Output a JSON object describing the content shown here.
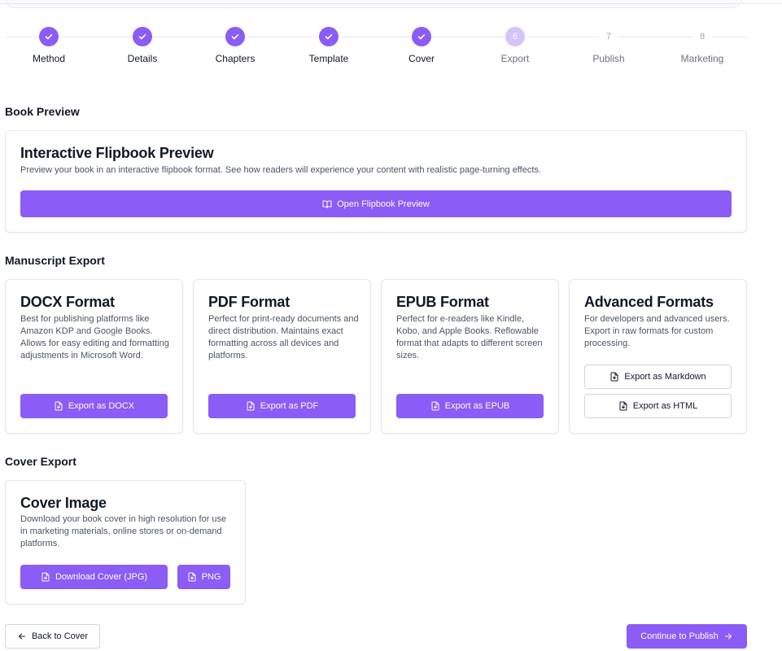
{
  "stepper": {
    "steps": [
      {
        "label": "Method",
        "number": "1",
        "state": "done"
      },
      {
        "label": "Details",
        "number": "2",
        "state": "done"
      },
      {
        "label": "Chapters",
        "number": "3",
        "state": "done"
      },
      {
        "label": "Template",
        "number": "4",
        "state": "done"
      },
      {
        "label": "Cover",
        "number": "5",
        "state": "done"
      },
      {
        "label": "Export",
        "number": "6",
        "state": "current"
      },
      {
        "label": "Publish",
        "number": "7",
        "state": "upcoming"
      },
      {
        "label": "Marketing",
        "number": "8",
        "state": "upcoming"
      }
    ]
  },
  "book_preview": {
    "section_title": "Book Preview",
    "card_title": "Interactive Flipbook Preview",
    "description": "Preview your book in an interactive flipbook format. See how readers will experience your content with realistic page-turning effects.",
    "button_label": "Open Flipbook Preview"
  },
  "manuscript_export": {
    "section_title": "Manuscript Export",
    "docx": {
      "title": "DOCX Format",
      "description": "Best for publishing platforms like Amazon KDP and Google Books. Allows for easy editing and formatting adjustments in Microsoft Word.",
      "button_label": "Export as DOCX"
    },
    "pdf": {
      "title": "PDF Format",
      "description": "Perfect for print-ready documents and direct distribution. Maintains exact formatting across all devices and platforms.",
      "button_label": "Export as PDF"
    },
    "epub": {
      "title": "EPUB Format",
      "description": "Perfect for e-readers like Kindle, Kobo, and Apple Books. Reflowable format that adapts to different screen sizes.",
      "button_label": "Export as EPUB"
    },
    "advanced": {
      "title": "Advanced Formats",
      "description": "For developers and advanced users. Export in raw formats for custom processing.",
      "markdown_label": "Export as Markdown",
      "html_label": "Export as HTML"
    }
  },
  "cover_export": {
    "section_title": "Cover Export",
    "card_title": "Cover Image",
    "description": "Download your book cover in high resolution for use in marketing materials, online stores or on-demand platforms.",
    "jpg_label": "Download Cover (JPG)",
    "png_label": "PNG"
  },
  "footer": {
    "back_label": "Back to Cover",
    "continue_label": "Continue to Publish"
  },
  "colors": {
    "accent": "#8b5cf6",
    "accent_light": "#d4c4fb",
    "border": "#e5e7eb",
    "text": "#111827",
    "muted": "#4b5563"
  },
  "icons": {
    "step_done": "check-icon",
    "flipbook": "open-book-icon",
    "export": "file-download-icon",
    "back": "arrow-left-icon",
    "continue": "arrow-right-icon"
  }
}
